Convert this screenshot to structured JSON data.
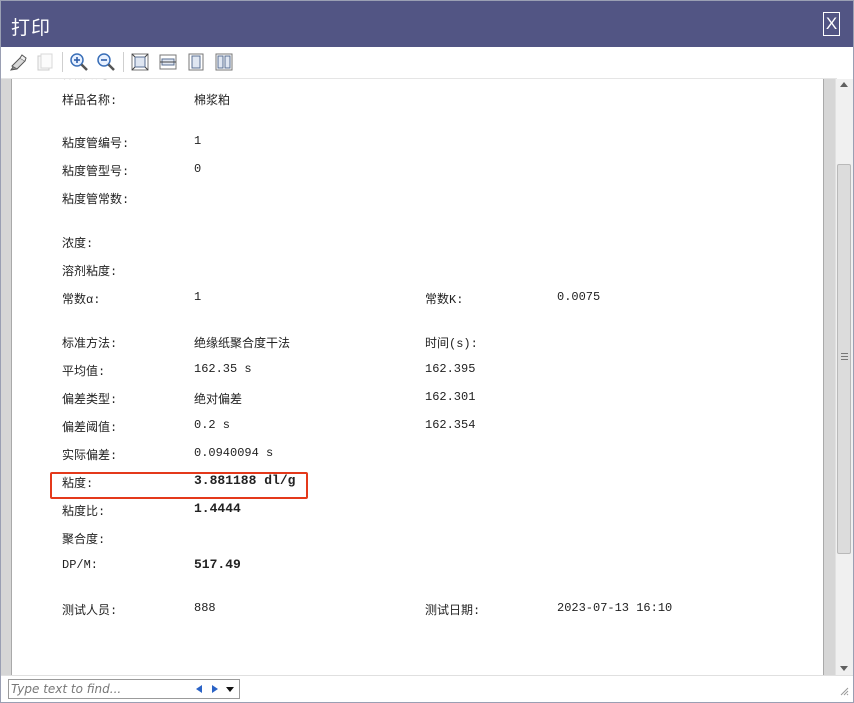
{
  "window": {
    "title": "打印",
    "close_label": "X"
  },
  "toolbar": {
    "buttons": [
      {
        "name": "print-icon"
      },
      {
        "name": "copy-icon"
      },
      {
        "name": "zoom-in-icon"
      },
      {
        "name": "zoom-out-icon"
      },
      {
        "name": "fit-page-icon"
      },
      {
        "name": "fit-width-icon"
      },
      {
        "name": "single-page-icon"
      },
      {
        "name": "two-page-icon"
      }
    ]
  },
  "report": {
    "sample_name": {
      "label": "样品名称:",
      "value": "棉浆粕"
    },
    "tube_number": {
      "label": "粘度管编号:",
      "value": "1"
    },
    "tube_model": {
      "label": "粘度管型号:",
      "value": "0"
    },
    "tube_constant": {
      "label": "粘度管常数:",
      "value": ""
    },
    "concentration": {
      "label": "浓度:",
      "value": ""
    },
    "solvent_viscosity": {
      "label": "溶剂粘度:",
      "value": ""
    },
    "constant_alpha": {
      "label": "常数α:",
      "value": "1"
    },
    "constant_k": {
      "label": "常数K:",
      "value": "0.0075"
    },
    "standard_method": {
      "label": "标准方法:",
      "value": "绝缘纸聚合度干法"
    },
    "time_header": {
      "label": "时间(s):"
    },
    "average": {
      "label": "平均值:",
      "value": "162.35 s"
    },
    "deviation_type": {
      "label": "偏差类型:",
      "value": "绝对偏差"
    },
    "deviation_threshold": {
      "label": "偏差阈值:",
      "value": "0.2 s"
    },
    "actual_deviation": {
      "label": "实际偏差:",
      "value": "0.0940094 s"
    },
    "times": [
      "162.395",
      "162.301",
      "162.354"
    ],
    "viscosity": {
      "label": "粘度:",
      "value": "3.881188 dl/g"
    },
    "viscosity_ratio": {
      "label": "粘度比:",
      "value": "1.4444"
    },
    "polymerization": {
      "label": "聚合度:",
      "value": ""
    },
    "dpm": {
      "label": "DP/M:",
      "value": "517.49"
    },
    "tester": {
      "label": "测试人员:",
      "value": "888"
    },
    "test_date": {
      "label": "测试日期:",
      "value": "2023-07-13 16:10"
    }
  },
  "find": {
    "placeholder": "Type text to find..."
  },
  "colors": {
    "titlebar": "#525584",
    "highlight": "#e4391b"
  }
}
